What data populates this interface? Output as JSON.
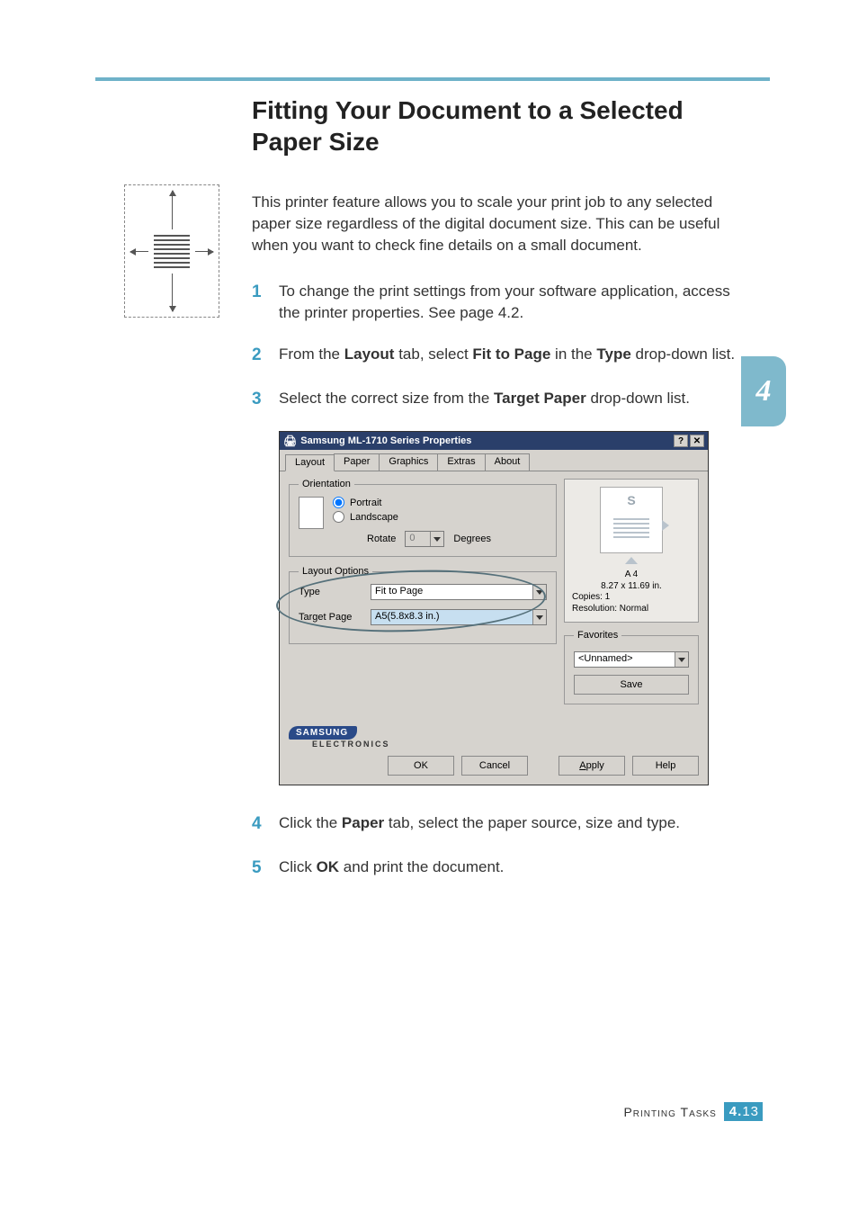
{
  "page": {
    "title": "Fitting Your Document to a Selected Paper Size",
    "intro": "This printer feature allows you to scale your print job to any selected paper size regardless of the digital document size. This can be useful when you want to check fine details on a small document.",
    "chapter_tab": "4",
    "footer_label": "Printing Tasks",
    "footer_chapter": "4.",
    "footer_page": "13"
  },
  "steps": {
    "s1": "To change the print settings from your software application, access the printer properties. See page 4.2.",
    "s2a": "From the ",
    "s2b": "Layout",
    "s2c": " tab, select ",
    "s2d": "Fit to Page",
    "s2e": " in the ",
    "s2f": "Type",
    "s2g": " drop-down list.",
    "s3a": "Select the correct size from the ",
    "s3b": "Target Paper",
    "s3c": " drop-down list.",
    "s4a": "Click the ",
    "s4b": "Paper",
    "s4c": " tab, select the paper source, size and type.",
    "s5a": "Click ",
    "s5b": "OK",
    "s5c": " and print the document."
  },
  "dialog": {
    "title": "Samsung ML-1710 Series Properties",
    "tabs": {
      "layout": "Layout",
      "paper": "Paper",
      "graphics": "Graphics",
      "extras": "Extras",
      "about": "About"
    },
    "orientation": {
      "legend": "Orientation",
      "portrait": "Portrait",
      "landscape": "Landscape",
      "rotate_label": "Rotate",
      "rotate_value": "0",
      "rotate_unit": "Degrees"
    },
    "layout_options": {
      "legend": "Layout Options",
      "type_label": "Type",
      "type_value": "Fit to Page",
      "target_label": "Target Page",
      "target_value": "A5(5.8x8.3 in.)"
    },
    "preview": {
      "paper_name": "A 4",
      "paper_dim": "8.27 x 11.69 in.",
      "copies": "Copies: 1",
      "resolution": "Resolution: Normal"
    },
    "favorites": {
      "legend": "Favorites",
      "value": "<Unnamed>",
      "save": "Save"
    },
    "brand": {
      "name": "SAMSUNG",
      "sub": "ELECTRONICS"
    },
    "buttons": {
      "ok": "OK",
      "cancel": "Cancel",
      "apply": "Apply",
      "help": "Help"
    },
    "titlebar_help": "?",
    "titlebar_close": "✕"
  }
}
